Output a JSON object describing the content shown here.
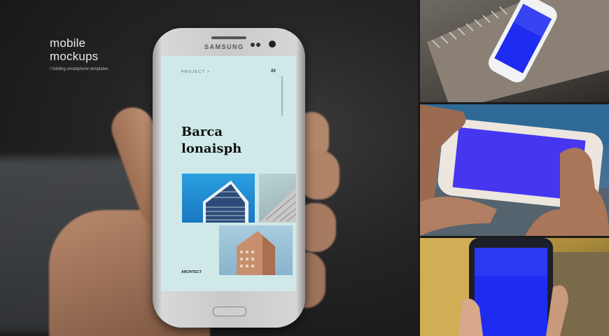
{
  "brand": {
    "title_line1": "mobile",
    "title_line2": "mockups",
    "subtitle": "/ holding smartphone templates"
  },
  "phone": {
    "brand_text": "SAMSUNG"
  },
  "screen": {
    "project_label": "PROJECT >",
    "page_number": "20",
    "headline_line1": "Barca",
    "headline_line2": "lonaisph",
    "footer_label": "ARCHITECT"
  },
  "colors": {
    "screen_bg": "#cfe9e9",
    "mockup_screen_blue": "#1d2cf0",
    "mockup_screen_purple": "#6a3ef0"
  }
}
